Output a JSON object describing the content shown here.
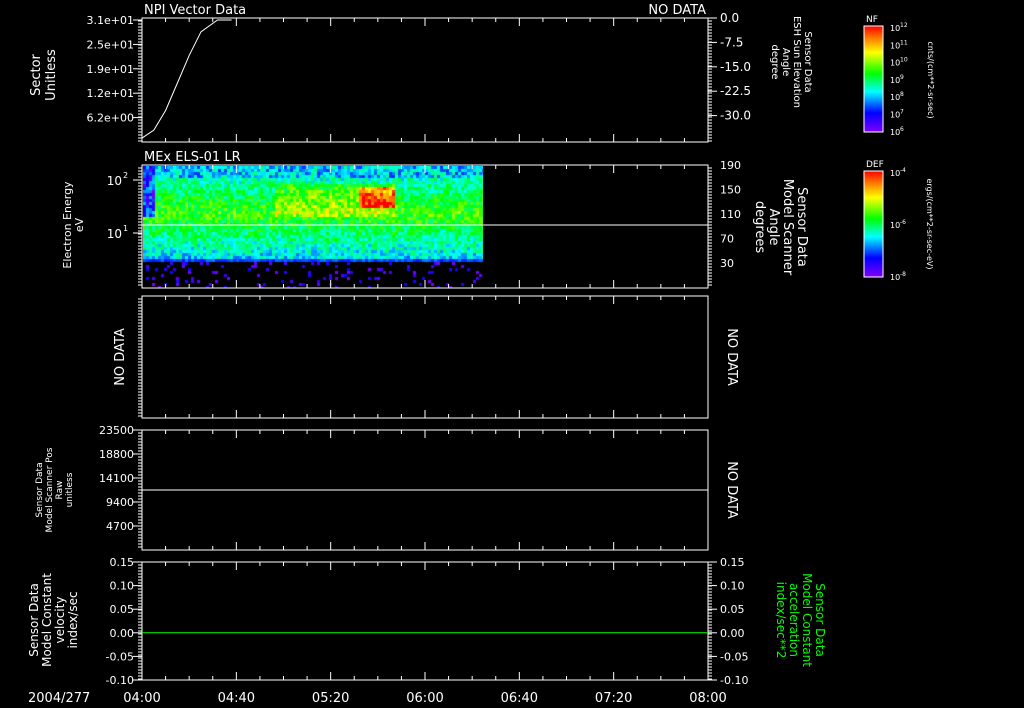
{
  "chart_data": [
    {
      "type": "line",
      "title": "NPI Vector Data",
      "status": "NO DATA",
      "ylabel": [
        "Sector",
        "Unitless"
      ],
      "yticks": [
        "3.1e+01",
        "2.5e+01",
        "1.9e+01",
        "1.2e+01",
        "6.2e+00"
      ],
      "ylim": [
        0,
        31
      ],
      "y2label": [
        "Sensor Data",
        "ESH Sun Elevation",
        "Angle",
        "degree"
      ],
      "y2ticks": [
        "0.0",
        "-7.5",
        "-15.0",
        "-22.5",
        "-30.0"
      ],
      "y2lim": [
        -37.5,
        0
      ],
      "series": [
        {
          "name": "Sector",
          "x_min": [
            0,
            5,
            10,
            15,
            20,
            25,
            32
          ],
          "values": [
            1,
            3,
            8,
            15,
            22,
            28,
            31
          ]
        }
      ]
    },
    {
      "type": "heatmap",
      "title": "MEx ELS-01 LR",
      "ylabel": [
        "Electron Energy",
        "eV"
      ],
      "yticks": [
        "10",
        "10"
      ],
      "yticks_exp": [
        "2",
        "1"
      ],
      "y2label": [
        "Sensor Data",
        "Model Scanner",
        "Angle",
        "degrees"
      ],
      "y2ticks": [
        "190",
        "150",
        "110",
        "70",
        "30"
      ],
      "data_end_min": 145,
      "line_value": 90,
      "colorbar": {
        "label": "DEF",
        "units": "ergs/(cm**2-sr-sec-eV)",
        "ticks": [
          "-4",
          "-6",
          "-8"
        ]
      }
    },
    {
      "type": "line",
      "left_text": "NO DATA",
      "right_text": "NO DATA"
    },
    {
      "type": "line",
      "ylabel": [
        "Sensor Data",
        "Model Scanner Pos",
        "Raw",
        "unitless"
      ],
      "yticks": [
        "23500",
        "18800",
        "14100",
        "9400",
        "4700"
      ],
      "ylim": [
        0,
        23500
      ],
      "right_text": "NO DATA",
      "series": [
        {
          "name": "Model Scanner Pos",
          "values": [
            11750,
            11750
          ]
        }
      ]
    },
    {
      "type": "line",
      "ylabel": [
        "Sensor Data",
        "Model Constant",
        "velocity",
        "index/sec"
      ],
      "yticks": [
        "0.15",
        "0.10",
        "0.05",
        "0.00",
        "-0.05",
        "-0.10"
      ],
      "ylim": [
        -0.1,
        0.15
      ],
      "y2label": [
        "Sensor Data",
        "Model Constant",
        "acceleration",
        "index/sec**2"
      ],
      "y2ticks": [
        "0.15",
        "0.10",
        "0.05",
        "0.00",
        "-0.05",
        "-0.10"
      ],
      "series": [
        {
          "name": "acceleration",
          "color": "#00ff00",
          "values": [
            0,
            0
          ]
        }
      ]
    }
  ],
  "xaxis": {
    "date": "2004/277",
    "ticks": [
      "04:00",
      "04:40",
      "05:20",
      "06:00",
      "06:40",
      "07:20",
      "08:00"
    ],
    "range_min": [
      0,
      240
    ]
  },
  "colorbar_nf": {
    "label": "NF",
    "units": "cnts/(cm**2-sr-sec)",
    "ticks": [
      "12",
      "11",
      "10",
      "9",
      "8",
      "7",
      "6"
    ]
  },
  "colors": {
    "axes": "#ffffff",
    "green": "#00ff00",
    "background": "#000000"
  }
}
